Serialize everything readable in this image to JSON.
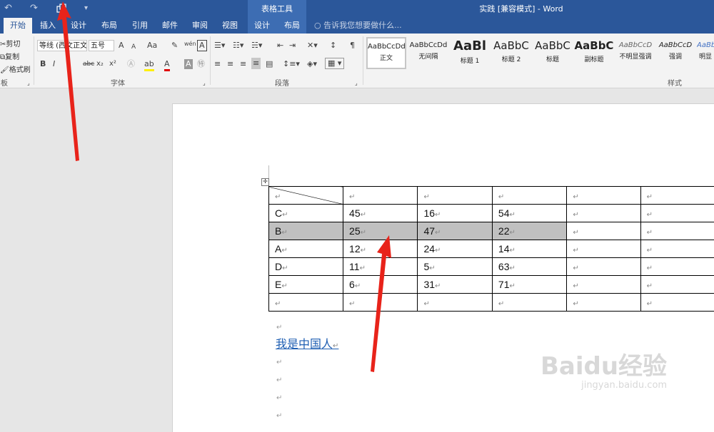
{
  "titlebar": {
    "undo": "↶",
    "redo": "↷",
    "quick_more": "▾",
    "table_tools": "表格工具",
    "doc_title": "实践 [兼容模式] - Word"
  },
  "tabs": [
    {
      "label": "开始",
      "active": true
    },
    {
      "label": "插入"
    },
    {
      "label": "设计"
    },
    {
      "label": "布局"
    },
    {
      "label": "引用"
    },
    {
      "label": "邮件"
    },
    {
      "label": "审阅"
    },
    {
      "label": "视图"
    },
    {
      "label": "设计"
    },
    {
      "label": "布局"
    }
  ],
  "tell_me": "告诉我您想要做什么...",
  "clipboard": {
    "cut": "剪切",
    "copy": "复制",
    "format_painter": "格式刷",
    "label": "板"
  },
  "font": {
    "name": "等线 (西文正文)",
    "size": "五号",
    "grow": "A",
    "shrink": "A",
    "case": "Aa",
    "bold": "B",
    "italic": "I",
    "strike": "abc",
    "sub": "x₂",
    "sup": "x²",
    "label": "字体"
  },
  "paragraph": {
    "label": "段落"
  },
  "styles": {
    "label": "样式",
    "items": [
      {
        "sample": "AaBbCcDd",
        "name": "正文",
        "selected": true
      },
      {
        "sample": "AaBbCcDd",
        "name": "无间隔"
      },
      {
        "sample": "AaBl",
        "name": "标题 1"
      },
      {
        "sample": "AaBbC",
        "name": "标题 2"
      },
      {
        "sample": "AaBbC",
        "name": "标题"
      },
      {
        "sample": "AaBbC",
        "name": "副标题"
      },
      {
        "sample": "AaBbCcD",
        "name": "不明显强调"
      },
      {
        "sample": "AaBbCcD",
        "name": "强调"
      },
      {
        "sample": "AaBbCcD",
        "name": "明显"
      }
    ]
  },
  "table": {
    "rows": [
      [
        "",
        "",
        "",
        "",
        "",
        ""
      ],
      [
        "C",
        "45",
        "16",
        "54",
        "",
        ""
      ],
      [
        "B",
        "25",
        "47",
        "22",
        "",
        ""
      ],
      [
        "A",
        "12",
        "24",
        "14",
        "",
        ""
      ],
      [
        "D",
        "11",
        "5",
        "63",
        "",
        ""
      ],
      [
        "E",
        "6",
        "31",
        "71",
        "",
        ""
      ],
      [
        "",
        "",
        "",
        "",
        "",
        ""
      ]
    ],
    "highlighted_row": 2,
    "para_mark": "↵"
  },
  "body_text": "我是中国人",
  "watermark": {
    "brand": "Baidu经验",
    "url": "jingyan.baidu.com"
  }
}
